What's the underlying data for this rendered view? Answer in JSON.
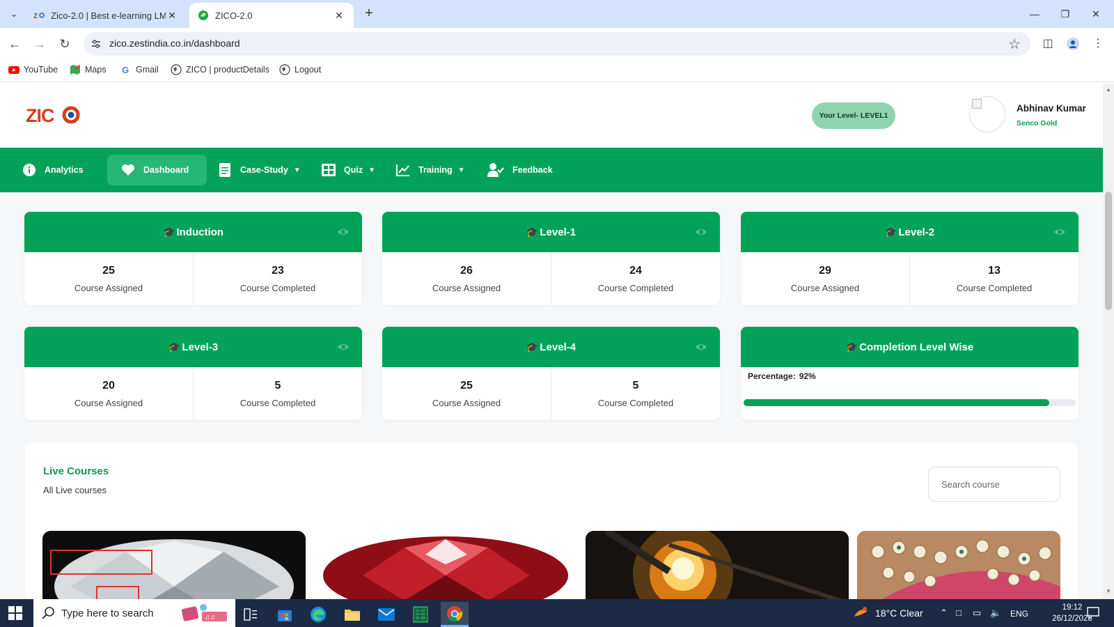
{
  "browser": {
    "tabs": [
      {
        "title": "Zico-2.0 | Best e-learning LMS In",
        "active": false
      },
      {
        "title": "ZICO-2.0",
        "active": true
      }
    ],
    "url": "zico.zestindia.co.in/dashboard",
    "bookmarks": [
      "YouTube",
      "Maps",
      "Gmail",
      "ZICO | productDetails",
      "Logout"
    ]
  },
  "header": {
    "logo_text": "ZICO",
    "level_badge": "Your Level- LEVEL1",
    "user_name": "Abhinav Kumar",
    "user_org": "Senco Gold"
  },
  "nav": {
    "items": [
      {
        "label": "Analytics",
        "icon": "info-icon",
        "dropdown": false
      },
      {
        "label": "Dashboard",
        "icon": "heart-icon",
        "dropdown": false,
        "active": true
      },
      {
        "label": "Case-Study",
        "icon": "document-icon",
        "dropdown": true
      },
      {
        "label": "Quiz",
        "icon": "grid-icon",
        "dropdown": true
      },
      {
        "label": "Training",
        "icon": "chart-line-icon",
        "dropdown": true
      },
      {
        "label": "Feedback",
        "icon": "user-check-icon",
        "dropdown": false
      }
    ]
  },
  "cards": [
    {
      "title": "Induction",
      "assigned": "25",
      "completed": "23",
      "assigned_label": "Course Assigned",
      "completed_label": "Course Completed"
    },
    {
      "title": "Level-1",
      "assigned": "26",
      "completed": "24",
      "assigned_label": "Course Assigned",
      "completed_label": "Course Completed"
    },
    {
      "title": "Level-2",
      "assigned": "29",
      "completed": "13",
      "assigned_label": "Course Assigned",
      "completed_label": "Course Completed"
    },
    {
      "title": "Level-3",
      "assigned": "20",
      "completed": "5",
      "assigned_label": "Course Assigned",
      "completed_label": "Course Completed"
    },
    {
      "title": "Level-4",
      "assigned": "25",
      "completed": "5",
      "assigned_label": "Course Assigned",
      "completed_label": "Course Completed"
    }
  ],
  "completion": {
    "title": "Completion Level Wise",
    "percentage_label": "Percentage:",
    "percentage_value": "92%",
    "progress_fraction": 0.92
  },
  "live_courses": {
    "title": "Live Courses",
    "subtitle": "All Live courses",
    "search_placeholder": "Search course",
    "thumbnails": [
      "diamond-image",
      "ruby-image",
      "gold-smelting-image",
      "jewellery-image"
    ]
  },
  "taskbar": {
    "search_placeholder": "Type here to search",
    "weather": "18°C  Clear",
    "language": "ENG",
    "time": "19:12",
    "date": "26/12/2023"
  },
  "colors": {
    "brand_green": "#03a259",
    "level_badge": "#8fd4b1",
    "title_green": "#0b9a4e"
  }
}
